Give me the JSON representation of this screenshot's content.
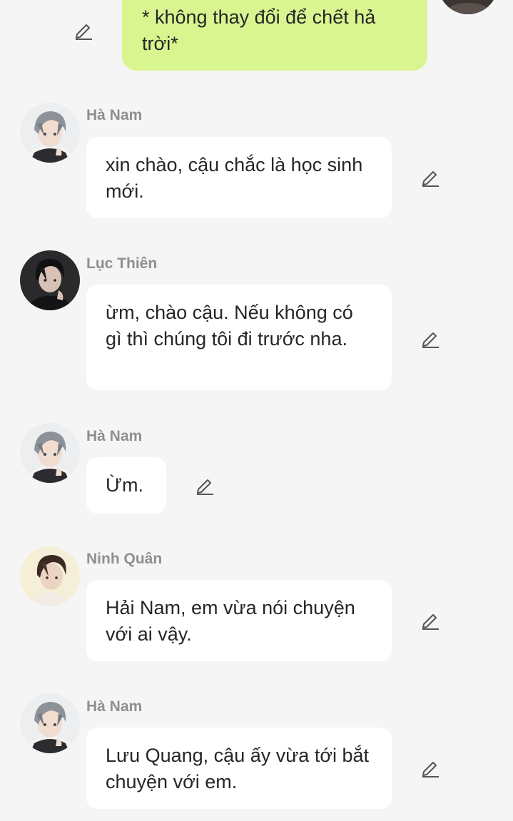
{
  "top_message": {
    "text": "* không thay đổi để chết hả trời*"
  },
  "messages": [
    {
      "sender": "Hà Nam",
      "avatar_icon": "boy-gray-hair-avatar",
      "text": "xin chào, cậu chắc là học sinh mới."
    },
    {
      "sender": "Lục Thiên",
      "avatar_icon": "dark-hair-boy-avatar",
      "text": "ừm, chào cậu. Nếu không có gì thì chúng tôi đi trước nha."
    },
    {
      "sender": "Hà Nam",
      "avatar_icon": "boy-gray-hair-avatar",
      "text": "Ừm."
    },
    {
      "sender": "Ninh Quân",
      "avatar_icon": "brown-hair-boy-avatar",
      "text": "Hải Nam, em vừa nói chuyện với ai vậy."
    },
    {
      "sender": "Hà Nam",
      "avatar_icon": "boy-gray-hair-avatar",
      "text": "Lưu Quang, cậu ấy vừa tới bắt chuyện với em."
    }
  ],
  "colors": {
    "background": "#f5f5f5",
    "incoming_bubble": "#ffffff",
    "outgoing_bubble": "#d9f590",
    "sender_name": "#8f8f8f",
    "message_text": "#262626",
    "edit_icon": "#555555"
  }
}
